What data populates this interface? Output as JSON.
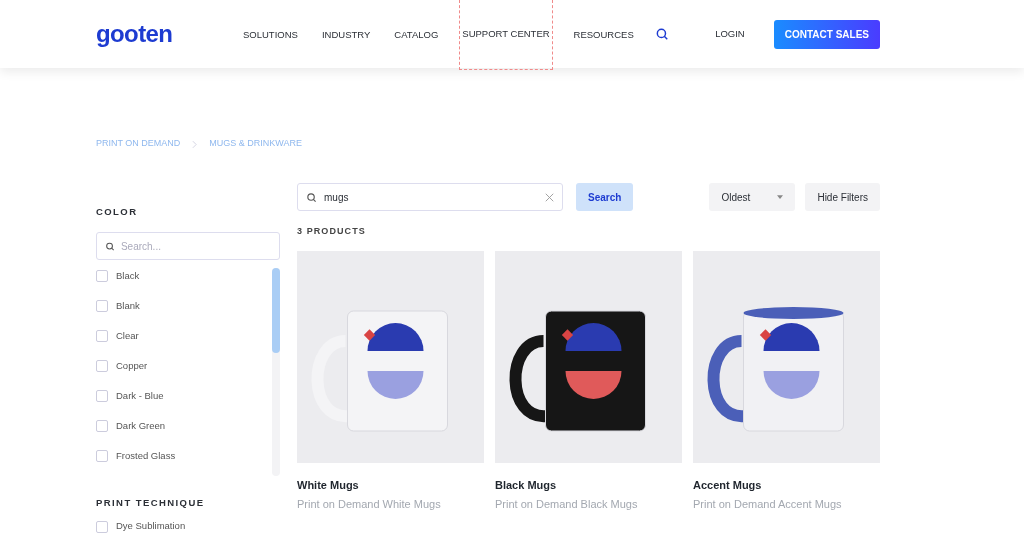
{
  "header": {
    "logo": "gooten",
    "nav": [
      {
        "label": "SOLUTIONS",
        "highlighted": false
      },
      {
        "label": "INDUSTRY",
        "highlighted": false
      },
      {
        "label": "CATALOG",
        "highlighted": false
      },
      {
        "label": "SUPPORT CENTER",
        "highlighted": true
      },
      {
        "label": "RESOURCES",
        "highlighted": false
      }
    ],
    "login": "LOGIN",
    "cta": "CONTACT SALES"
  },
  "breadcrumb": [
    "PRINT ON DEMAND",
    "MUGS & DRINKWARE"
  ],
  "filters": [
    {
      "title": "COLOR",
      "search_placeholder": "Search...",
      "options": [
        {
          "label": "Black",
          "checked": false
        },
        {
          "label": "Blank",
          "checked": false
        },
        {
          "label": "Clear",
          "checked": false
        },
        {
          "label": "Copper",
          "checked": false
        },
        {
          "label": "Dark - Blue",
          "checked": false
        },
        {
          "label": "Dark Green",
          "checked": false
        },
        {
          "label": "Frosted Glass",
          "checked": false
        }
      ]
    },
    {
      "title": "PRINT TECHNIQUE",
      "options": [
        {
          "label": "Dye Sublimation",
          "checked": false
        }
      ]
    }
  ],
  "search": {
    "value": "mugs",
    "button": "Search"
  },
  "count": "3 PRODUCTS",
  "sort": "Oldest",
  "hide_filters": "Hide Filters",
  "products": [
    {
      "kind": "white",
      "name": "White Mugs",
      "subtitle": "Print on Demand White Mugs"
    },
    {
      "kind": "black",
      "name": "Black Mugs",
      "subtitle": "Print on Demand Black Mugs"
    },
    {
      "kind": "accent",
      "name": "Accent Mugs",
      "subtitle": "Print on Demand Accent Mugs"
    }
  ]
}
